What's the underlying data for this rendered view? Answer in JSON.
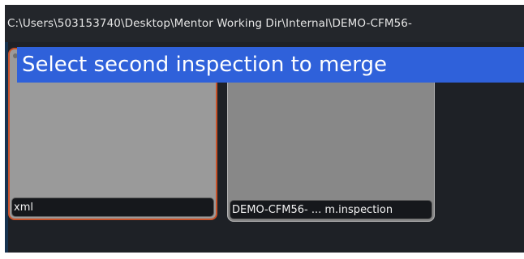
{
  "path_bar": {
    "path": "C:\\Users\\503153740\\Desktop\\Mentor Working Dir\\Internal\\DEMO-CFM56-"
  },
  "banner": {
    "text": "Select second inspection to merge"
  },
  "inspections": [
    {
      "label": "xml",
      "selected": true
    },
    {
      "label": "DEMO-CFM56- ... m.inspection",
      "selected": false
    }
  ],
  "colors": {
    "background": "#1e2126",
    "banner": "#2f61da",
    "selection_border": "#c9532a",
    "thumbnail_1": "#9a9a9a",
    "thumbnail_2": "#888888"
  }
}
